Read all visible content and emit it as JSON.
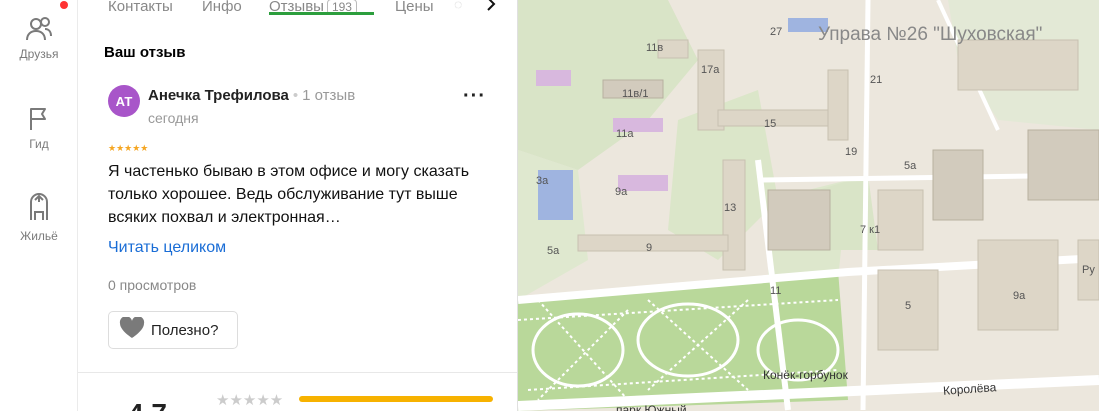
{
  "rail": {
    "items": [
      {
        "label": "Друзья",
        "icon": "friends-icon"
      },
      {
        "label": "Гид",
        "icon": "flag-icon"
      },
      {
        "label": "Жильё",
        "icon": "housing-icon"
      }
    ],
    "badge_color": "#ff3333"
  },
  "tabs": {
    "items": [
      "Контакты",
      "Инфо",
      "Отзывы",
      "Цены"
    ],
    "reviews_count": "193",
    "active": "Отзывы",
    "next_icon": "chevron-right-icon"
  },
  "review": {
    "section_title": "Ваш отзыв",
    "avatar_initials": "АТ",
    "avatar_color": "#a855c9",
    "author_name": "Анечка Трефилова",
    "author_reviews": "1 отзыв",
    "date": "сегодня",
    "rating": 5,
    "stars": "★★★★★",
    "text": "Я частенько бываю в этом офисе и могу сказать только хорошее. Ведь обслуживание тут выше всяких похвал и электронная…",
    "read_more": "Читать целиком",
    "views": "0 просмотров",
    "useful_label": "Полезно?",
    "more_icon": "more-dots-icon"
  },
  "summary": {
    "rating": "4.7",
    "stars": "★★★★★"
  },
  "map": {
    "title": "Управа №26 \"Шуховская\"",
    "labels": [
      "27",
      "11в",
      "17а",
      "21",
      "11в/1",
      "15",
      "11а",
      "19",
      "5а",
      "3а",
      "9а",
      "13",
      "7 к1",
      "9",
      "5а",
      "11",
      "5",
      "9а",
      "Ру"
    ],
    "poi": "Конёк-горбунок",
    "street": "Королёва",
    "park": "парк Южный"
  },
  "colors": {
    "accent_green": "#2c9e3d",
    "link_blue": "#1a6dd6",
    "star_gold": "#f5a623",
    "bar_yellow": "#f7b200"
  }
}
